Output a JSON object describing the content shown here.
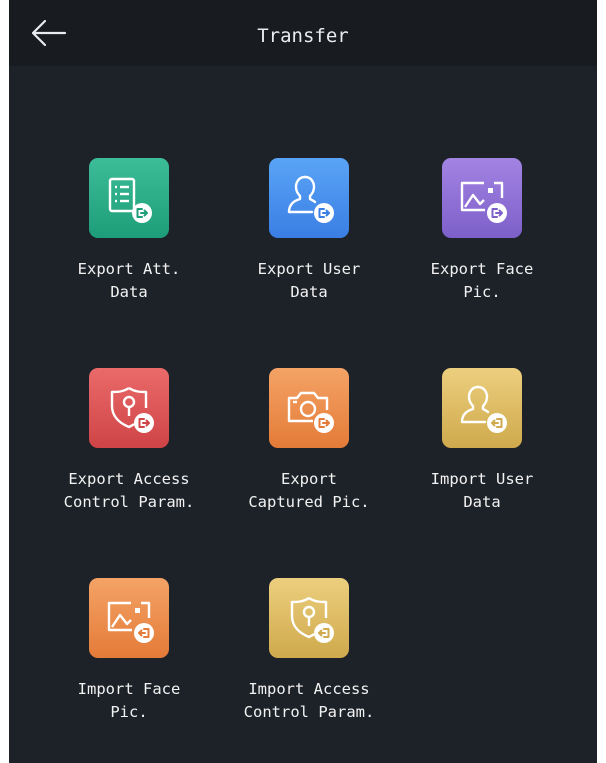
{
  "header": {
    "title": "Transfer",
    "back_icon": "arrow-left-icon"
  },
  "colors": {
    "background": "#1d2228",
    "header": "#181c20",
    "text": "#f2f2f2"
  },
  "items": [
    {
      "label": "Export Att.\nData",
      "icon": "attendance-export-icon"
    },
    {
      "label": "Export User\nData",
      "icon": "user-export-icon"
    },
    {
      "label": "Export Face\nPic.",
      "icon": "face-picture-export-icon"
    },
    {
      "label": "Export Access\nControl Param.",
      "icon": "access-control-export-icon"
    },
    {
      "label": "Export\nCaptured Pic.",
      "icon": "camera-export-icon"
    },
    {
      "label": "Import User\nData",
      "icon": "user-import-icon"
    },
    {
      "label": "Import Face\nPic.",
      "icon": "face-picture-import-icon"
    },
    {
      "label": "Import Access\nControl Param.",
      "icon": "access-control-import-icon"
    }
  ]
}
